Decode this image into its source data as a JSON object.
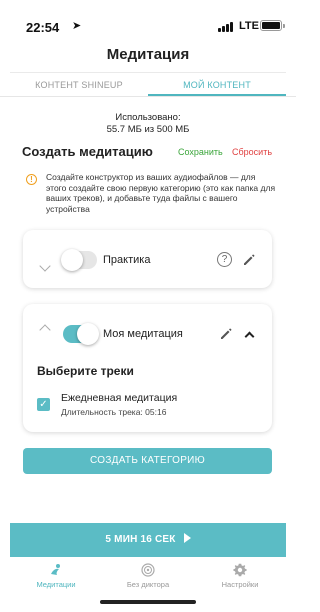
{
  "status_bar": {
    "time": "22:54",
    "network": "LTE"
  },
  "header": {
    "title": "Медитация"
  },
  "tabs": [
    {
      "label": "КОНТЕНТ SHINEUP",
      "active": false
    },
    {
      "label": "МОЙ КОНТЕНТ",
      "active": true
    }
  ],
  "usage": {
    "label": "Использовано:",
    "value": "55.7 МБ из 500 МБ"
  },
  "create_section": {
    "title": "Создать медитацию",
    "save_label": "Сохранить",
    "reset_label": "Сбросить",
    "info_text": "Создайте конструктор из ваших аудиофайлов — для этого создайте свою первую категорию (это как папка для ваших треков), и добавьте туда файлы с вашего устройства"
  },
  "categories": [
    {
      "name": "Практика",
      "enabled": false,
      "expanded": false
    },
    {
      "name": "Моя медитация",
      "enabled": true,
      "expanded": true,
      "select_tracks_label": "Выберите треки",
      "tracks": [
        {
          "name": "Ежедневная медитация",
          "duration": "Длительность трека: 05:16",
          "checked": true
        }
      ]
    }
  ],
  "create_category_button": "Создать категорию",
  "play_bar": {
    "label": "5 МИН 16 СЕК"
  },
  "bottom_nav": [
    {
      "label": "Медитации",
      "icon": "meditation-icon",
      "active": true
    },
    {
      "label": "Без диктора",
      "icon": "no-narrator-icon",
      "active": false
    },
    {
      "label": "Настройки",
      "icon": "settings-gear-icon",
      "active": false
    }
  ],
  "colors": {
    "accent": "#5bbcc5",
    "save": "#3aa53a",
    "reset": "#e04040",
    "info": "#f0a020"
  }
}
